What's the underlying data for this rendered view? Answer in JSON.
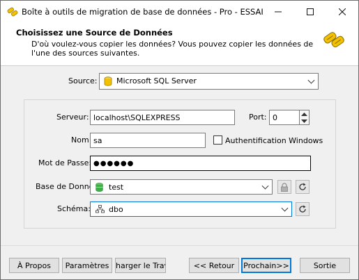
{
  "window": {
    "title": "Boîte à outils de migration de base de données - Pro - ESSAI"
  },
  "header": {
    "title": "Choisissez une Source de Données",
    "subtitle": "D'où voulez-vous copier les données? Vous pouvez copier les données de l'une des sources suivantes."
  },
  "form": {
    "source_label": "Source:",
    "source_value": "Microsoft SQL Server",
    "server_label": "Serveur:",
    "server_value": "localhost\\SQLEXPRESS",
    "port_label": "Port:",
    "port_value": "0",
    "name_label": "Nom",
    "name_value": "sa",
    "windows_auth_label": "Authentification Windows",
    "password_label": "Mot de Passe:",
    "password_value": "●●●●●●",
    "database_label": "Base de Donné",
    "database_value": "test",
    "schema_label": "Schéma:",
    "schema_value": "dbo"
  },
  "footer": {
    "about": "À Propos",
    "settings": "Paramètres",
    "load_job": "harger le Trava",
    "back": "<< Retour",
    "next": "Prochain>>",
    "exit": "Sortie"
  },
  "colors": {
    "accent": "#0078d7",
    "db_yellow": "#f2c200",
    "db_green": "#3fae49"
  }
}
